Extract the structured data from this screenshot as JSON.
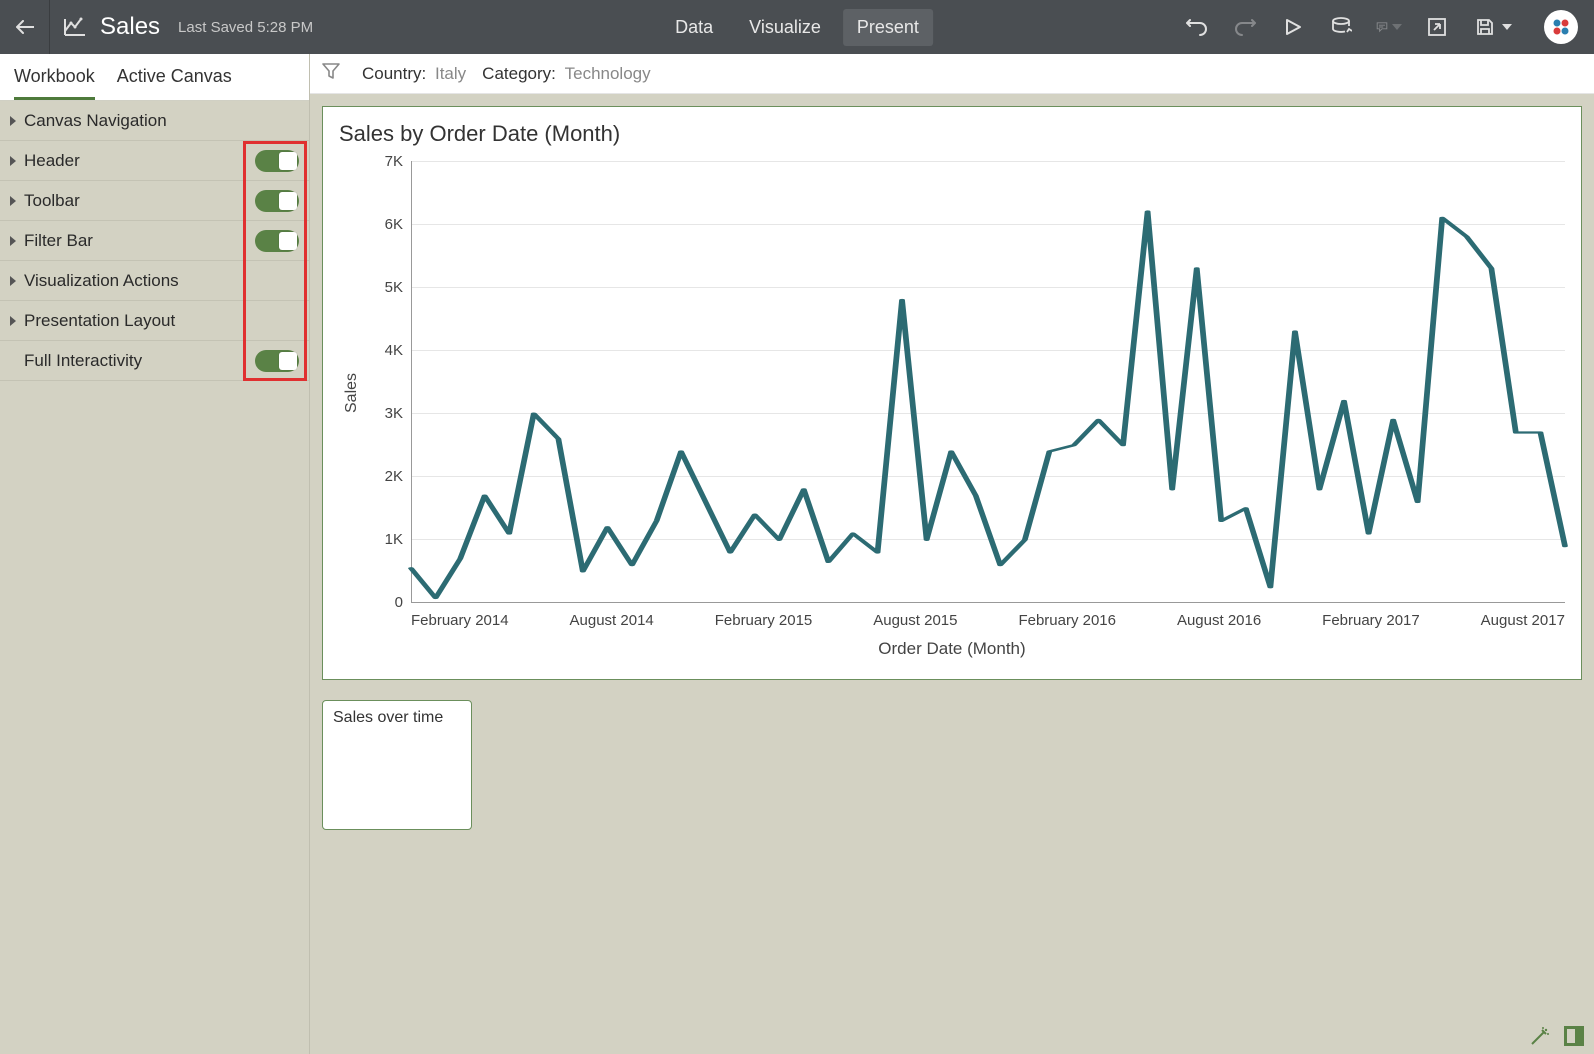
{
  "topbar": {
    "title": "Sales",
    "last_saved": "Last Saved 5:28 PM",
    "tabs": {
      "data": "Data",
      "visualize": "Visualize",
      "present": "Present"
    }
  },
  "sidebar": {
    "tabs": {
      "workbook": "Workbook",
      "active_canvas": "Active Canvas"
    },
    "items": [
      {
        "label": "Canvas Navigation",
        "toggle": false
      },
      {
        "label": "Header",
        "toggle": true
      },
      {
        "label": "Toolbar",
        "toggle": true
      },
      {
        "label": "Filter Bar",
        "toggle": true
      },
      {
        "label": "Visualization Actions",
        "toggle": false
      },
      {
        "label": "Presentation Layout",
        "toggle": false
      },
      {
        "label": "Full Interactivity",
        "toggle": true,
        "no_tri": true
      }
    ]
  },
  "filters": {
    "country_label": "Country:",
    "country_value": "Italy",
    "category_label": "Category:",
    "category_value": "Technology"
  },
  "chart_card": {
    "title": "Sales by Order Date (Month)"
  },
  "thumb": {
    "label": "Sales over time"
  },
  "chart_data": {
    "type": "line",
    "title": "Sales by Order Date (Month)",
    "xlabel": "Order Date (Month)",
    "ylabel": "Sales",
    "ylim": [
      0,
      7000
    ],
    "y_ticks": [
      "7K",
      "6K",
      "5K",
      "4K",
      "3K",
      "2K",
      "1K",
      "0"
    ],
    "x_tick_labels": [
      "February 2014",
      "August 2014",
      "February 2015",
      "August 2015",
      "February 2016",
      "August 2016",
      "February 2017",
      "August 2017"
    ],
    "x": [
      0,
      1,
      2,
      3,
      4,
      5,
      6,
      7,
      8,
      9,
      10,
      11,
      12,
      13,
      14,
      15,
      16,
      17,
      18,
      19,
      20,
      21,
      22,
      23,
      24,
      25,
      26,
      27,
      28,
      29,
      30,
      31,
      32,
      33,
      34,
      35,
      36,
      37,
      38,
      39,
      40,
      41,
      42,
      43,
      44,
      45,
      46,
      47
    ],
    "values": [
      550,
      80,
      700,
      1700,
      1100,
      3000,
      2600,
      500,
      1200,
      600,
      1300,
      2400,
      1600,
      800,
      1400,
      1000,
      1800,
      650,
      1100,
      800,
      4800,
      1000,
      2400,
      1700,
      600,
      1000,
      2400,
      2500,
      2900,
      2500,
      6200,
      1800,
      5300,
      1300,
      1500,
      250,
      4300,
      1800,
      3200,
      1100,
      2900,
      1600,
      6100,
      5800,
      5300,
      2700,
      2700,
      900
    ]
  }
}
